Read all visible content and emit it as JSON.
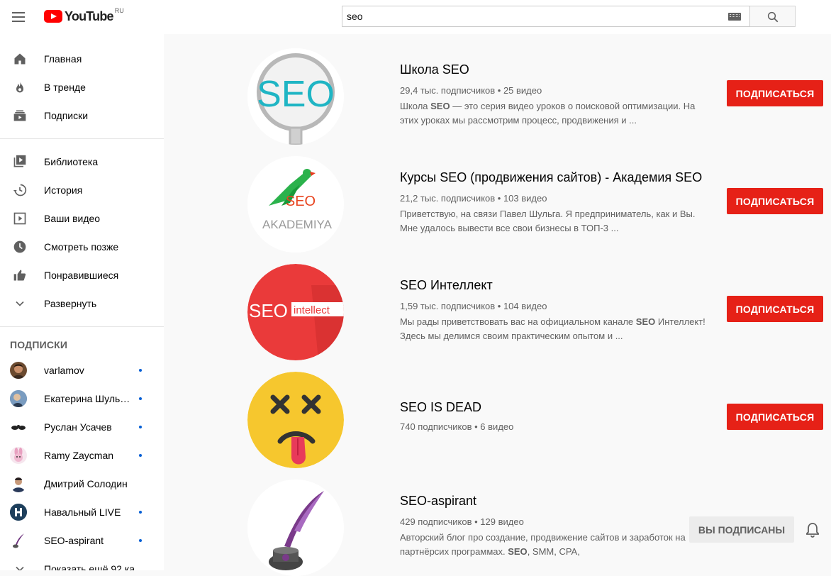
{
  "header": {
    "logo_text": "YouTube",
    "logo_region": "RU",
    "search_value": "seo"
  },
  "sidebar": {
    "primary": [
      {
        "label": "Главная",
        "icon": "home-icon"
      },
      {
        "label": "В тренде",
        "icon": "fire-icon"
      },
      {
        "label": "Подписки",
        "icon": "subscriptions-icon"
      }
    ],
    "library": [
      {
        "label": "Библиотека",
        "icon": "library-icon"
      },
      {
        "label": "История",
        "icon": "history-icon"
      },
      {
        "label": "Ваши видео",
        "icon": "your-videos-icon"
      },
      {
        "label": "Смотреть позже",
        "icon": "watch-later-icon"
      },
      {
        "label": "Понравившиеся",
        "icon": "thumbs-up-icon"
      },
      {
        "label": "Развернуть",
        "icon": "chevron-down-icon"
      }
    ],
    "subscriptions_title": "ПОДПИСКИ",
    "subscriptions": [
      {
        "name": "varlamov",
        "new": true,
        "color": "#6b4a2f"
      },
      {
        "name": "Екатерина Шульман",
        "new": true,
        "color": "#5a7fa8"
      },
      {
        "name": "Руслан Усачев",
        "new": true,
        "color": "#333333"
      },
      {
        "name": "Ramy Zaycman",
        "new": true,
        "color": "#e8a0c0"
      },
      {
        "name": "Дмитрий Солодин",
        "new": false,
        "color": "#2a3a5a"
      },
      {
        "name": "Навальный LIVE",
        "new": true,
        "color": "#1a3a5a"
      },
      {
        "name": "SEO-aspirant",
        "new": true,
        "color": "#6a2d7a"
      }
    ],
    "show_more": "Показать ещё 92 ка"
  },
  "results": [
    {
      "title": "Школа SEO",
      "meta": "29,4 тыс. подписчиков • 25 видео",
      "desc_line1": "Школа ",
      "desc_bold1": "SEO",
      "desc_line1b": " — это серия видео уроков о поисковой оптимизации. На этих уроках мы рассмотрим процесс, продвижения и ...",
      "button": "ПОДПИСАТЬСЯ",
      "subscribed": false
    },
    {
      "title": "Курсы SEO (продвижения сайтов) - Академия SEO",
      "meta": "21,2 тыс. подписчиков • 103 видео",
      "desc": "Приветствую, на связи Павел Шульга. Я предприниматель, как и Вы. Мне удалось вывести все свои бизнесы в ТОП-3 ...",
      "button": "ПОДПИСАТЬСЯ",
      "subscribed": false
    },
    {
      "title": "SEO Интеллект",
      "meta": "1,59 тыс. подписчиков • 104 видео",
      "desc_pre": "Мы рады приветствовать вас на официальном канале ",
      "desc_bold": "SEO",
      "desc_post": " Интеллект! Здесь мы делимся своим практическим опытом и ...",
      "button": "ПОДПИСАТЬСЯ",
      "subscribed": false
    },
    {
      "title": "SEO IS DEAD",
      "meta": "740 подписчиков • 6 видео",
      "button": "ПОДПИСАТЬСЯ",
      "subscribed": false
    },
    {
      "title": "SEO-aspirant",
      "meta": "429 подписчиков • 129 видео",
      "desc_pre": "Авторский блог про создание, продвижение сайтов и заработок на партнёрсих программах. ",
      "desc_bold": "SEO",
      "desc_mid": ", SMM, CPA,",
      "button": "ВЫ ПОДПИСАНЫ",
      "subscribed": true
    }
  ],
  "avatars": {
    "r0_text": "SEO",
    "r1_text_top": "SEO",
    "r1_text_bottom": "AKADEMIYA",
    "r2_text_a": "SEO",
    "r2_text_b": "intellect"
  },
  "colors": {
    "subscribe_red": "#e62117",
    "accent_blue": "#065fd4",
    "text_secondary": "#606060"
  }
}
